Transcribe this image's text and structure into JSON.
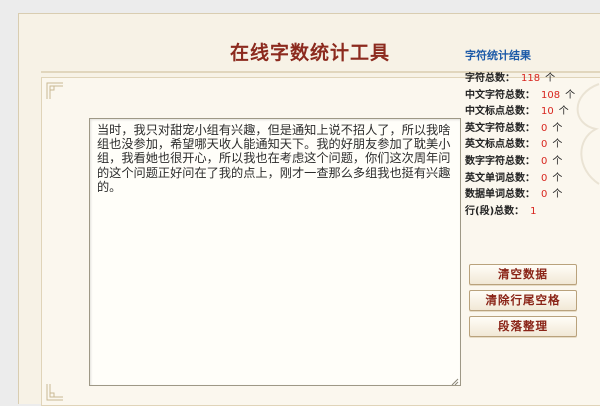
{
  "page": {
    "title": "在线字数统计工具"
  },
  "editor": {
    "text": "当时，我只对甜宠小组有兴趣，但是通知上说不招人了，所以我啥组也没参加，希望哪天收人能通知天下。我的好朋友参加了耽美小组，我看她也很开心，所以我也在考虑这个问题，你们这次周年问的这个问题正好问在了我的点上，刚才一查那么多组我也挺有兴趣的。"
  },
  "stats": {
    "title": "字符统计结果",
    "unit": "个",
    "items": [
      {
        "label": "字符总数：",
        "value": "118",
        "unit": "个"
      },
      {
        "label": "中文字符总数：",
        "value": "108",
        "unit": "个"
      },
      {
        "label": "中文标点总数：",
        "value": "10",
        "unit": "个"
      },
      {
        "label": "英文字符总数：",
        "value": "0",
        "unit": "个"
      },
      {
        "label": "英文标点总数：",
        "value": "0",
        "unit": "个"
      },
      {
        "label": "数字字符总数：",
        "value": "0",
        "unit": "个"
      },
      {
        "label": "英文单词总数：",
        "value": "0",
        "unit": "个"
      },
      {
        "label": "数据单词总数：",
        "value": "0",
        "unit": "个"
      },
      {
        "label": "行(段)总数：",
        "value": "1",
        "unit": ""
      }
    ]
  },
  "buttons": {
    "clear": "清空数据",
    "trim": "清除行尾空格",
    "format": "段落整理"
  },
  "colors": {
    "title": "#8c2a1e",
    "stats_title": "#1d5aa8",
    "value": "#d8261f",
    "panel_bg": "#f7f2e6"
  }
}
